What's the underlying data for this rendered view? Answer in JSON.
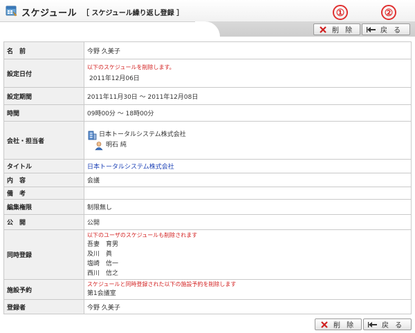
{
  "header": {
    "title": "スケジュール",
    "subtitle": "［ スケジュール繰り返し登録 ］"
  },
  "annotations": {
    "one": "①",
    "two": "②"
  },
  "buttons": {
    "delete_label": "削 除",
    "back_label": "戻 る"
  },
  "rows": {
    "name": {
      "label": "名　前",
      "value": "今野 久美子"
    },
    "setdate": {
      "label": "設定日付",
      "note": "以下のスケジュールを削除します。",
      "value": "2011年12月06日"
    },
    "period": {
      "label": "設定期間",
      "value": "2011年11月30日 ～ 2011年12月08日"
    },
    "time": {
      "label": "時間",
      "value": "09時00分 ～ 18時00分"
    },
    "company": {
      "label": "会社・担当者",
      "company": "日本トータルシステム株式会社",
      "person": "明石 純"
    },
    "titlerow": {
      "label": "タイトル",
      "value": "日本トータルシステム株式会社"
    },
    "content": {
      "label": "内　容",
      "value": "会議"
    },
    "memo": {
      "label": "備　考",
      "value": ""
    },
    "edit": {
      "label": "編集権限",
      "value": "制限無し"
    },
    "public": {
      "label": "公　開",
      "value": "公開"
    },
    "simul": {
      "label": "同時登録",
      "note": "以下のユーザのスケジュールも削除されます",
      "users": [
        "吾妻　育男",
        "及川　眞",
        "塩崎　信一",
        "西川　信之"
      ]
    },
    "facility": {
      "label": "施設予約",
      "note": "スケジュールと同時登録された以下の施設予約を削除します",
      "value": "第1会議室"
    },
    "registrant": {
      "label": "登録者",
      "value": "今野 久美子"
    }
  },
  "colors": {
    "accent_red": "#d32020",
    "link_blue": "#1a3fb5",
    "label_bg": "#f0f0f0"
  },
  "icons": [
    "schedule-app-icon",
    "delete-x-icon",
    "back-arrow-icon",
    "building-icon",
    "person-icon"
  ]
}
